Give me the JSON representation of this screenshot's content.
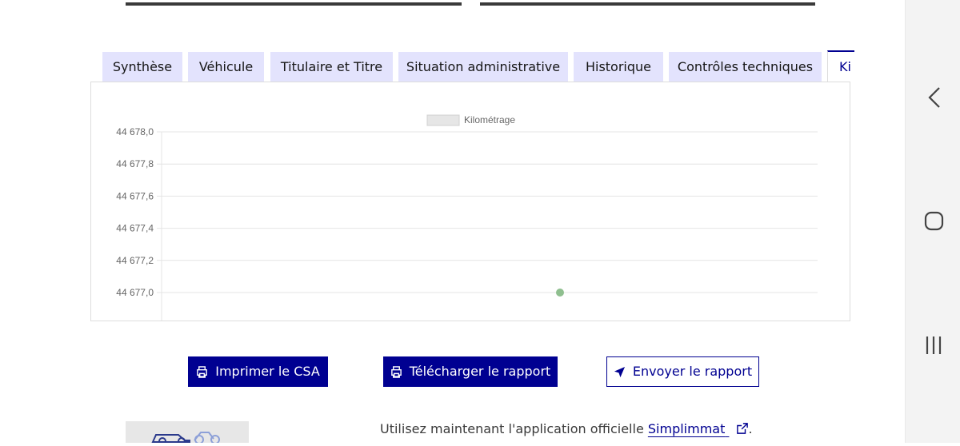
{
  "tabs": [
    {
      "label": "Synthèse"
    },
    {
      "label": "Véhicule"
    },
    {
      "label": "Titulaire et Titre"
    },
    {
      "label": "Situation administrative"
    },
    {
      "label": "Historique"
    },
    {
      "label": "Contrôles techniques"
    },
    {
      "label": "Ki",
      "active": true
    }
  ],
  "chart_data": {
    "type": "scatter",
    "legend": [
      "Kilométrage"
    ],
    "legend_position": "top",
    "y_ticks": [
      "44 678,0",
      "44 677,8",
      "44 677,6",
      "44 677,4",
      "44 677,2",
      "44 677,0"
    ],
    "ylim": [
      44676.8,
      44678.0
    ],
    "grid": true,
    "points": [
      {
        "y": 44677.0
      }
    ],
    "point_color": "#8fbf8f"
  },
  "buttons": {
    "print_csa": "Imprimer le CSA",
    "download_report": "Télécharger le rapport",
    "send_report": "Envoyer le rapport"
  },
  "promo": {
    "text_before": "Utilisez maintenant l'application officielle ",
    "link": "Simplimmat",
    "text_after": "."
  },
  "colors": {
    "primary": "#000091",
    "tab_bg": "#e3e3fd"
  }
}
